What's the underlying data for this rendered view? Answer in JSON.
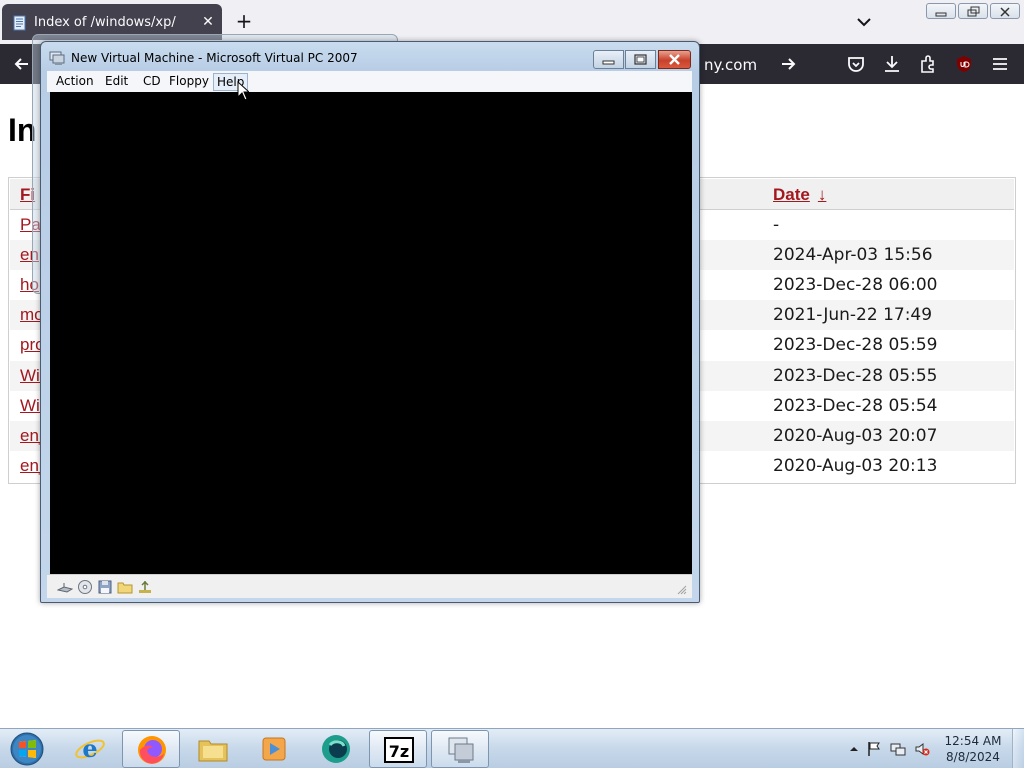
{
  "browser": {
    "tab": {
      "title": "Index of /windows/xp/"
    },
    "address_bar": {
      "visible_text": "ny.com"
    },
    "colors": {
      "toolbar_bg": "#2b2a33",
      "link": "#a3171f"
    }
  },
  "page": {
    "heading": "In",
    "table": {
      "headers": {
        "name": "Fi",
        "date": "Date",
        "date_sort_indicator": "↓"
      },
      "rows": [
        {
          "name": "Pa",
          "date": "-"
        },
        {
          "name": "en",
          "date": "2024-Apr-03 15:56"
        },
        {
          "name": "ho",
          "date": "2023-Dec-28 06:00"
        },
        {
          "name": "mo",
          "date": "2021-Jun-22 17:49"
        },
        {
          "name": "pro",
          "date": "2023-Dec-28 05:59"
        },
        {
          "name": "Win",
          "date": "2023-Dec-28 05:55"
        },
        {
          "name": "Wir",
          "date": "2023-Dec-28 05:54"
        },
        {
          "name": "en_",
          "date": "2020-Aug-03 20:07"
        },
        {
          "name": "en_",
          "date": "2020-Aug-03 20:13"
        }
      ]
    }
  },
  "vpc_window": {
    "title": "New Virtual Machine - Microsoft Virtual PC 2007",
    "menu": [
      "Action",
      "Edit",
      "CD",
      "Floppy",
      "Help"
    ],
    "hovered_menu": "Help",
    "status_icons": [
      "network-icon",
      "cd-drive-icon",
      "floppy-icon",
      "shared-folder-icon",
      "usb-icon"
    ]
  },
  "taskbar": {
    "pinned": [
      "internet-explorer",
      "firefox",
      "explorer",
      "media-player",
      "webstorm",
      "7-zip",
      "virtual-pc"
    ],
    "open": [
      "firefox",
      "7-zip",
      "virtual-pc"
    ],
    "clock": {
      "time": "12:54 AM",
      "date": "8/8/2024"
    }
  }
}
